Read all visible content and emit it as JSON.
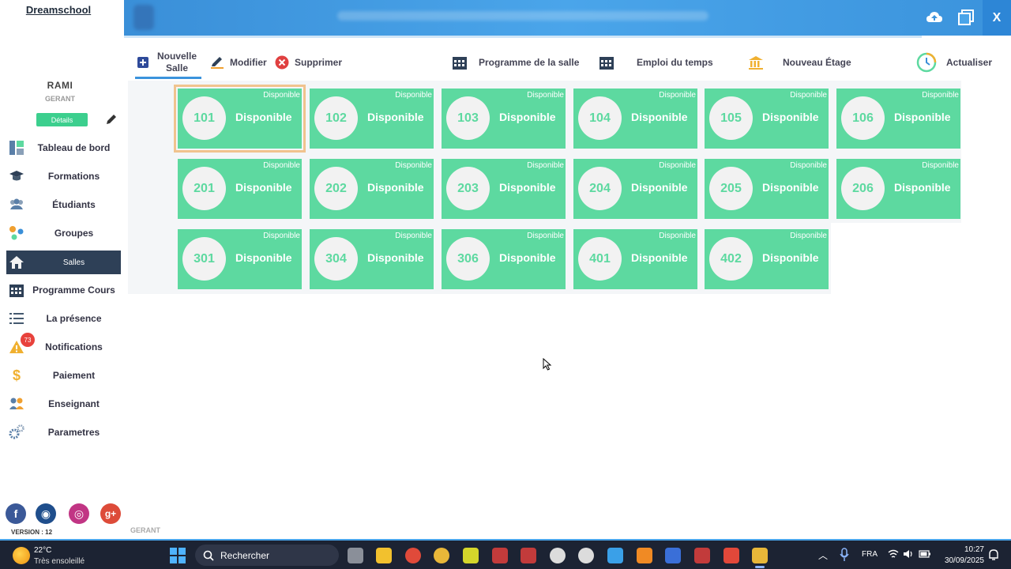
{
  "sidebar": {
    "brand": "Dreamschool",
    "user_name": "RAMI",
    "user_role": "GERANT",
    "details_label": "Détails",
    "items": [
      {
        "label": "Tableau de bord",
        "icon": "dashboard-icon"
      },
      {
        "label": "Formations",
        "icon": "graduation-cap-icon"
      },
      {
        "label": "Étudiants",
        "icon": "students-icon"
      },
      {
        "label": "Groupes",
        "icon": "groups-icon"
      },
      {
        "label": "Salles",
        "icon": "home-icon",
        "active": true
      },
      {
        "label": "Programme Cours",
        "icon": "calendar-icon"
      },
      {
        "label": "La présence",
        "icon": "checklist-icon"
      },
      {
        "label": "Notifications",
        "icon": "warning-icon",
        "badge": "73"
      },
      {
        "label": "Paiement",
        "icon": "dollar-icon"
      },
      {
        "label": "Enseignant",
        "icon": "teacher-icon"
      },
      {
        "label": "Parametres",
        "icon": "gears-icon"
      }
    ],
    "social": [
      {
        "icon": "facebook-icon",
        "glyph": "f",
        "color": "#3b5998"
      },
      {
        "icon": "website-icon",
        "glyph": "◉",
        "color": "#1f4e8c"
      },
      {
        "icon": "instagram-icon",
        "glyph": "◎",
        "color": "#c13584"
      },
      {
        "icon": "google-plus-icon",
        "glyph": "g+",
        "color": "#dd4b39"
      }
    ],
    "version": "VERSION : 12"
  },
  "topbar": {
    "close_label": "X",
    "cloud_icon": "cloud-upload-icon",
    "window_icon": "window-restore-icon"
  },
  "toolbar": {
    "new_room": "Nouvelle Salle",
    "edit": "Modifier",
    "delete": "Supprimer",
    "room_schedule": "Programme de la salle",
    "timetable": "Emploi du temps",
    "new_floor": "Nouveau Étage",
    "refresh": "Actualiser"
  },
  "rooms": [
    {
      "number": "101",
      "status": "Disponible",
      "selected": true
    },
    {
      "number": "102",
      "status": "Disponible"
    },
    {
      "number": "103",
      "status": "Disponible"
    },
    {
      "number": "104",
      "status": "Disponible"
    },
    {
      "number": "105",
      "status": "Disponible"
    },
    {
      "number": "106",
      "status": "Disponible"
    },
    {
      "number": "201",
      "status": "Disponible"
    },
    {
      "number": "202",
      "status": "Disponible"
    },
    {
      "number": "203",
      "status": "Disponible"
    },
    {
      "number": "204",
      "status": "Disponible"
    },
    {
      "number": "205",
      "status": "Disponible"
    },
    {
      "number": "206",
      "status": "Disponible"
    },
    {
      "number": "301",
      "status": "Disponible"
    },
    {
      "number": "304",
      "status": "Disponible"
    },
    {
      "number": "306",
      "status": "Disponible"
    },
    {
      "number": "401",
      "status": "Disponible"
    },
    {
      "number": "402",
      "status": "Disponible"
    }
  ],
  "footer_role": "GERANT",
  "taskbar": {
    "temperature": "22°C",
    "weather": "Très ensoleillé",
    "search_placeholder": "Rechercher",
    "language": "FRA",
    "time": "10:27",
    "date": "30/09/2025",
    "apps": [
      {
        "name": "task-view-icon",
        "color": "#8a8f99"
      },
      {
        "name": "file-explorer-icon",
        "color": "#f2c12e"
      },
      {
        "name": "chrome-icon",
        "color": "#e04a3a"
      },
      {
        "name": "app-yellow-icon",
        "color": "#e8b739"
      },
      {
        "name": "app-24-icon",
        "color": "#d4d62b"
      },
      {
        "name": "app-chart-icon",
        "color": "#c23b3b"
      },
      {
        "name": "app-chart-2-icon",
        "color": "#c23b3b"
      },
      {
        "name": "app-link-icon",
        "color": "#dcdcdc"
      },
      {
        "name": "app-link-2-icon",
        "color": "#dcdcdc"
      },
      {
        "name": "app-play-icon",
        "color": "#3aa0e8"
      },
      {
        "name": "app-play-2-icon",
        "color": "#f08a24"
      },
      {
        "name": "app-shield-icon",
        "color": "#3a6fd8"
      },
      {
        "name": "app-chart-3-icon",
        "color": "#c23b3b"
      },
      {
        "name": "app-red-icon",
        "color": "#e2483a"
      },
      {
        "name": "windev-icon",
        "color": "#e8b739",
        "active": true
      }
    ]
  }
}
